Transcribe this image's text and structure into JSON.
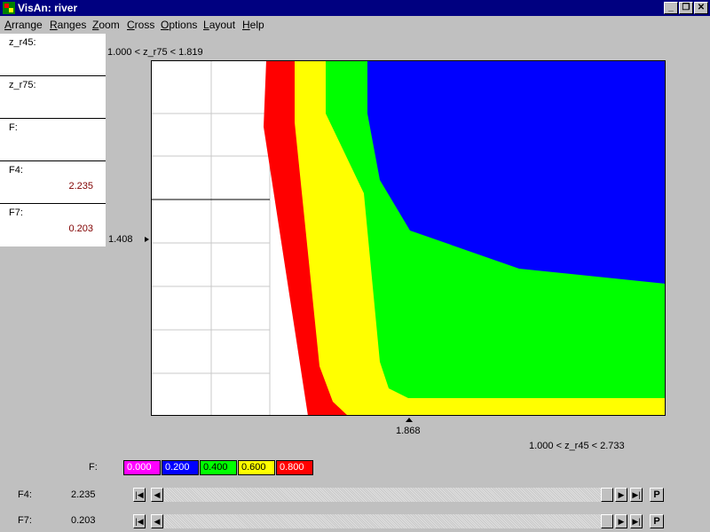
{
  "window": {
    "title": "VisAn: river",
    "buttons": {
      "minimize": "_",
      "restore": "❐",
      "close": "✕"
    }
  },
  "menu": [
    {
      "label": "Arrange",
      "mnemonic": "A",
      "rest": "rrange"
    },
    {
      "label": "Ranges",
      "mnemonic": "R",
      "rest": "anges"
    },
    {
      "label": "Zoom",
      "mnemonic": "Z",
      "rest": "oom"
    },
    {
      "label": "Cross",
      "mnemonic": "C",
      "rest": "ross"
    },
    {
      "label": "Options",
      "mnemonic": "O",
      "rest": "ptions"
    },
    {
      "label": "Layout",
      "mnemonic": "L",
      "rest": "ayout"
    },
    {
      "label": "Help",
      "mnemonic": "H",
      "rest": "elp"
    }
  ],
  "info_panel": [
    {
      "label": "z_r45:",
      "value": ""
    },
    {
      "label": "z_r75:",
      "value": ""
    },
    {
      "label": "F:",
      "value": ""
    },
    {
      "label": "F4:",
      "value": "2.235"
    },
    {
      "label": "F7:",
      "value": "0.203"
    }
  ],
  "plot": {
    "y_range_label": "1.000 < z_r75 < 1.819",
    "x_range_label": "1.000 < z_r45 < 2.733",
    "y_marker_value": "1.408",
    "x_marker_value": "1.868",
    "x_range": [
      1.0,
      2.733
    ],
    "y_range": [
      1.0,
      1.819
    ]
  },
  "legend": {
    "label": "F:",
    "items": [
      {
        "value": "0.000",
        "color": "#ff00ff",
        "text_color": "#ffffff"
      },
      {
        "value": "0.200",
        "color": "#0000ff",
        "text_color": "#ffffff"
      },
      {
        "value": "0.400",
        "color": "#00ff00",
        "text_color": "#000000"
      },
      {
        "value": "0.600",
        "color": "#ffff00",
        "text_color": "#000000"
      },
      {
        "value": "0.800",
        "color": "#ff0000",
        "text_color": "#ffffff"
      }
    ]
  },
  "sliders": [
    {
      "label": "F4:",
      "value": "2.235",
      "button": "P"
    },
    {
      "label": "F7:",
      "value": "0.203",
      "button": "P"
    }
  ]
}
